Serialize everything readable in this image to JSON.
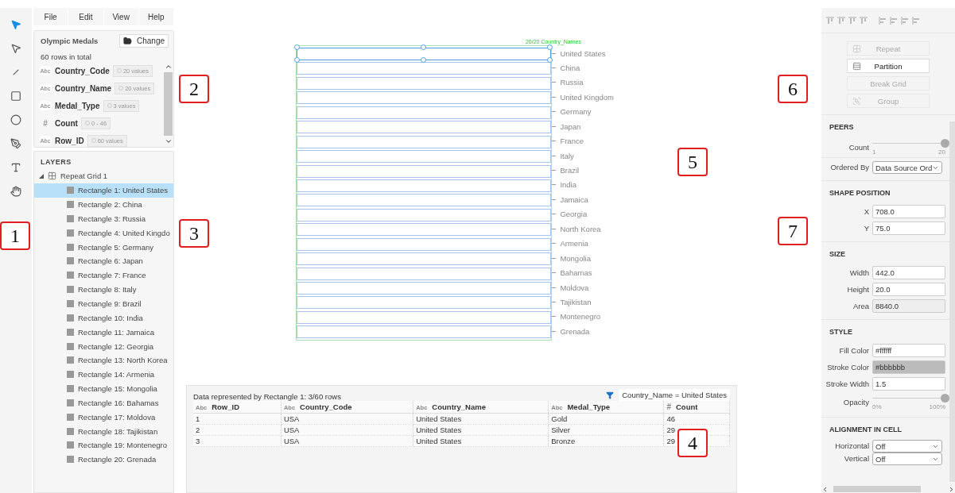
{
  "menu": [
    "File",
    "Edit",
    "View",
    "Help"
  ],
  "tools": [
    {
      "kind": "select",
      "selected": true
    },
    {
      "kind": "direct",
      "selected": false
    },
    {
      "kind": "line",
      "selected": false
    },
    {
      "kind": "rect",
      "selected": false
    },
    {
      "kind": "ellipse",
      "selected": false
    },
    {
      "kind": "pen",
      "selected": false
    },
    {
      "kind": "text",
      "selected": false
    },
    {
      "kind": "hand",
      "selected": false
    }
  ],
  "dataset": {
    "title": "Olympic Medals",
    "change_button": "Change",
    "row_total": "60 rows in total",
    "fields": [
      {
        "type": "Abc",
        "name": "Country_Code",
        "badge": "20 values"
      },
      {
        "type": "Abc",
        "name": "Country_Name",
        "badge": "20 values"
      },
      {
        "type": "Abc",
        "name": "Medal_Type",
        "badge": "3 values"
      },
      {
        "type": "#",
        "name": "Count",
        "badge": "0 - 46"
      },
      {
        "type": "Abc",
        "name": "Row_ID",
        "badge": "60 values"
      }
    ]
  },
  "layers": {
    "title": "LAYERS",
    "tree": [
      {
        "label": "Repeat Grid 1",
        "expanded": true,
        "selected": false,
        "children": [
          {
            "label": "Rectangle 1: United States",
            "selected": true
          },
          {
            "label": "Rectangle 2: China",
            "selected": false
          },
          {
            "label": "Rectangle 3: Russia",
            "selected": false
          },
          {
            "label": "Rectangle 4: United Kingdo",
            "selected": false
          },
          {
            "label": "Rectangle 5: Germany",
            "selected": false
          },
          {
            "label": "Rectangle 6: Japan",
            "selected": false
          },
          {
            "label": "Rectangle 7: France",
            "selected": false
          },
          {
            "label": "Rectangle 8: Italy",
            "selected": false
          },
          {
            "label": "Rectangle 9: Brazil",
            "selected": false
          },
          {
            "label": "Rectangle 10: India",
            "selected": false
          },
          {
            "label": "Rectangle 11: Jamaica",
            "selected": false
          },
          {
            "label": "Rectangle 12: Georgia",
            "selected": false
          },
          {
            "label": "Rectangle 13: North Korea",
            "selected": false
          },
          {
            "label": "Rectangle 14: Armenia",
            "selected": false
          },
          {
            "label": "Rectangle 15: Mongolia",
            "selected": false
          },
          {
            "label": "Rectangle 16: Bahamas",
            "selected": false
          },
          {
            "label": "Rectangle 17: Moldova",
            "selected": false
          },
          {
            "label": "Rectangle 18: Tajikistan",
            "selected": false
          },
          {
            "label": "Rectangle 19: Montenegro",
            "selected": false
          },
          {
            "label": "Rectangle 20: Grenada",
            "selected": false
          }
        ]
      }
    ]
  },
  "canvas": {
    "axis_title": "20/20 Country_Names",
    "rows": [
      {
        "label": "United States",
        "selected": true
      },
      {
        "label": "China",
        "selected": false
      },
      {
        "label": "Russia",
        "selected": false
      },
      {
        "label": "United Kingdom",
        "selected": false
      },
      {
        "label": "Germany",
        "selected": false
      },
      {
        "label": "Japan",
        "selected": false
      },
      {
        "label": "France",
        "selected": false
      },
      {
        "label": "Italy",
        "selected": false
      },
      {
        "label": "Brazil",
        "selected": false
      },
      {
        "label": "India",
        "selected": false
      },
      {
        "label": "Jamaica",
        "selected": false
      },
      {
        "label": "Georgia",
        "selected": false
      },
      {
        "label": "North Korea",
        "selected": false
      },
      {
        "label": "Armenia",
        "selected": false
      },
      {
        "label": "Mongolia",
        "selected": false
      },
      {
        "label": "Bahamas",
        "selected": false
      },
      {
        "label": "Moldova",
        "selected": false
      },
      {
        "label": "Tajikistan",
        "selected": false
      },
      {
        "label": "Montenegro",
        "selected": false
      },
      {
        "label": "Grenada",
        "selected": false
      }
    ]
  },
  "data_table": {
    "caption": "Data represented by Rectangle 1: 3/60 rows",
    "filter": "Country_Name = United States",
    "columns": [
      {
        "type": "Abc",
        "name": "Row_ID"
      },
      {
        "type": "Abc",
        "name": "Country_Code"
      },
      {
        "type": "Abc",
        "name": "Country_Name"
      },
      {
        "type": "Abc",
        "name": "Medal_Type"
      },
      {
        "type": "#",
        "name": "Count"
      }
    ],
    "rows": [
      [
        "1",
        "USA",
        "United States",
        "Gold",
        "46"
      ],
      [
        "2",
        "USA",
        "United States",
        "Silver",
        "29"
      ],
      [
        "3",
        "USA",
        "United States",
        "Bronze",
        "29"
      ]
    ]
  },
  "inspector": {
    "grid_buttons": [
      {
        "kind": "repeat",
        "label": "Repeat",
        "disabled": true
      },
      {
        "kind": "partition",
        "label": "Partition",
        "disabled": false
      },
      {
        "kind": "none",
        "label": "Break Grid",
        "disabled": true
      },
      {
        "kind": "group",
        "label": "Group",
        "disabled": true
      }
    ],
    "peers": {
      "title": "PEERS",
      "count_label": "Count",
      "level": 1,
      "min": "1",
      "max": "20",
      "ordered_label": "Ordered By",
      "ordered_value": "Data Source Ord"
    },
    "position": {
      "title": "SHAPE POSITION",
      "fields": [
        {
          "label": "X",
          "value": "708.0",
          "disabled": false
        },
        {
          "label": "Y",
          "value": "75.0",
          "disabled": false
        }
      ]
    },
    "size": {
      "title": "SIZE",
      "fields": [
        {
          "label": "Width",
          "value": "442.0",
          "disabled": false
        },
        {
          "label": "Height",
          "value": "20.0",
          "disabled": false
        },
        {
          "label": "Area",
          "value": "8840.0",
          "disabled": true
        }
      ]
    },
    "style": {
      "title": "STYLE",
      "fill_label": "Fill Color",
      "fill_value": "#ffffff",
      "stroke_label": "Stroke Color",
      "stroke_value": "#bbbbbb",
      "width_label": "Stroke Width",
      "width_value": "1.5",
      "opacity_label": "Opacity",
      "level": 1,
      "min": "0%",
      "max": "100%"
    },
    "alignment": {
      "title": "ALIGNMENT IN CELL",
      "fields": [
        {
          "label": "Horizontal",
          "value": "Off"
        },
        {
          "label": "Vertical",
          "value": "Off"
        }
      ]
    }
  },
  "callouts": [
    "1",
    "2",
    "3",
    "4",
    "5",
    "6",
    "7"
  ]
}
